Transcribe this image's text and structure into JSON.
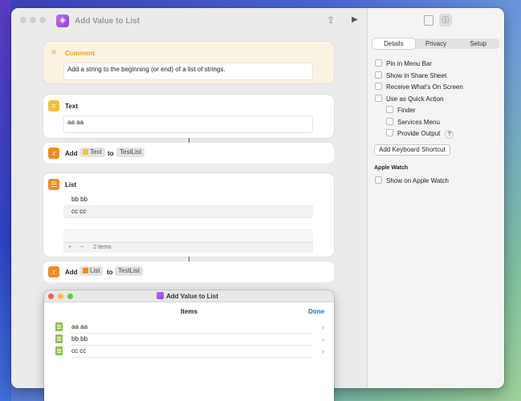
{
  "window": {
    "title": "Add Value to List"
  },
  "actions": {
    "comment": {
      "title": "Comment",
      "text": "Add a string to the beginning (or end) of a list of strings."
    },
    "text": {
      "title": "Text",
      "value": "aa aa"
    },
    "add1": {
      "verb": "Add",
      "value": "Text",
      "to": "to",
      "target": "TestList"
    },
    "list": {
      "title": "List",
      "items": [
        "bb bb",
        "cc cc"
      ],
      "count": "2 items",
      "add": "+",
      "remove": "−"
    },
    "add2": {
      "verb": "Add",
      "value": "List",
      "to": "to",
      "target": "TestList"
    }
  },
  "inspector": {
    "tabs": [
      "Details",
      "Privacy",
      "Setup"
    ],
    "options": [
      "Pin in Menu Bar",
      "Show in Share Sheet",
      "Receive What's On Screen",
      "Use as Quick Action"
    ],
    "quick_action_sub": [
      "Finder",
      "Services Menu",
      "Provide Output"
    ],
    "help": "?",
    "shortcut_button": "Add Keyboard Shortcut",
    "apple_watch_title": "Apple Watch",
    "apple_watch_option": "Show on Apple Watch"
  },
  "sheet": {
    "title": "Add Value to List",
    "header": "Items",
    "done": "Done",
    "items": [
      "aa aa",
      "bb bb",
      "cc cc"
    ],
    "chevron": "›"
  },
  "colors": {
    "accent": "#1f6fd1",
    "text_icon": "#f2c230",
    "variable_icon": "#f08c1f"
  }
}
